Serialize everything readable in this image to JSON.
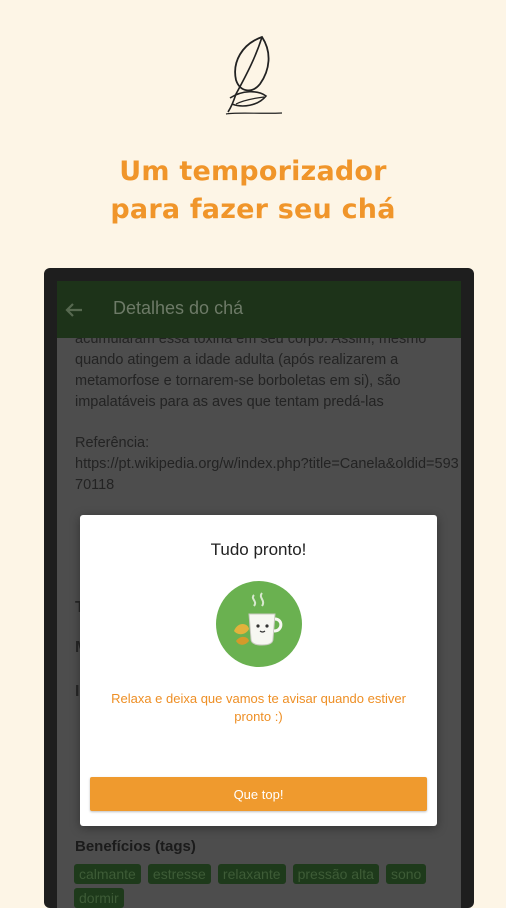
{
  "headline": {
    "line1": "Um temporizador",
    "line2": "para fazer seu chá"
  },
  "appbar": {
    "title": "Detalhes do chá",
    "back_icon": "arrow-left-icon"
  },
  "description": {
    "text": "acumularam essa toxina em seu corpo. Assim, mesmo quando atingem a idade adulta (após realizarem a metamorfose e tornarem-se borboletas em si), são impalatáveis para as aves que tentam predá-las",
    "reference_label": "Referência:",
    "reference_url": "https://pt.wikipedia.org/w/index.php?title=Canela&oldid=59370118"
  },
  "benefits": {
    "title": "Benefícios (tags)",
    "tags": [
      "calmante",
      "estresse",
      "relaxante",
      "pressão alta",
      "sono",
      "dormir"
    ]
  },
  "dialog": {
    "title": "Tudo pronto!",
    "icon": "tea-cup-icon",
    "message": "Relaxa e deixa que vamos te avisar quando estiver pronto :)",
    "button_label": "Que top!"
  },
  "colors": {
    "background": "#fdf5e6",
    "accent": "#f0952a",
    "appbar": "#1d3319",
    "icon_circle": "#6ab150",
    "button": "#ef9a2e"
  }
}
